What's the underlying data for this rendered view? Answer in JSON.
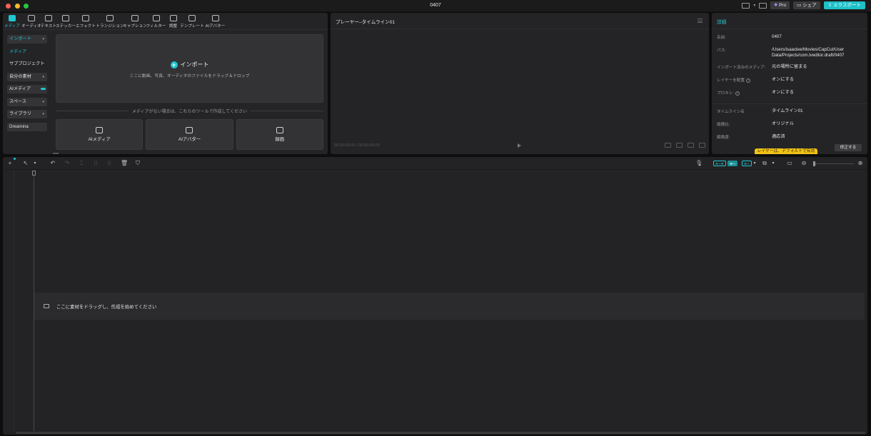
{
  "window": {
    "title": "0407",
    "buttons": {
      "pro": "Pro",
      "share": "シェア",
      "export": "エクスポート"
    }
  },
  "media": {
    "tabs": [
      {
        "label": "メディア",
        "icon": "media-icon"
      },
      {
        "label": "オーディオ",
        "icon": "audio-icon"
      },
      {
        "label": "テキスト",
        "icon": "text-icon"
      },
      {
        "label": "ステッカー",
        "icon": "sticker-icon"
      },
      {
        "label": "エフェクト",
        "icon": "effect-icon"
      },
      {
        "label": "トランジション",
        "icon": "transition-icon"
      },
      {
        "label": "キャプション",
        "icon": "caption-icon"
      },
      {
        "label": "フィルター",
        "icon": "filter-icon"
      },
      {
        "label": "調整",
        "icon": "adjust-icon"
      },
      {
        "label": "テンプレート",
        "icon": "template-icon"
      },
      {
        "label": "AIアバター",
        "icon": "ai-avatar-icon"
      }
    ],
    "sidebar": [
      {
        "label": "インポート",
        "style": "active-box"
      },
      {
        "label": "メディア",
        "style": "active-text"
      },
      {
        "label": "サブプロジェクト",
        "style": "plain"
      },
      {
        "label": "自分の素材",
        "style": "box"
      },
      {
        "label": "AIメディア",
        "style": "box"
      },
      {
        "label": "スペース",
        "style": "box"
      },
      {
        "label": "ライブラリ",
        "style": "box"
      },
      {
        "label": "Dreamina",
        "style": "box"
      }
    ],
    "import_zone": {
      "title": "インポート",
      "hint": "ここに動画、写真、オーディオのファイルをドラッグ＆ドロップ"
    },
    "divider_text": "メディアがない場合は、これらのツールで作成してください",
    "tool_cards": [
      {
        "label": "AIメディア",
        "icon": "ai-media-icon"
      },
      {
        "label": "AIアバター",
        "icon": "ai-avatar-icon"
      },
      {
        "label": "録画",
        "icon": "record-icon"
      }
    ]
  },
  "player": {
    "title": "プレーヤー–タイムライン01",
    "timecode": "00:00:00:00 / 00:00:00:00"
  },
  "details": {
    "title": "詳細",
    "rows": [
      {
        "key": "名前:",
        "value": "0407"
      },
      {
        "key": "パス:",
        "value": "/Users/isaaclee/Movies/CapCut/User Data/Projects/com.lveditor.draft/0407"
      },
      {
        "key": "インポート済みのメディア:",
        "value": "元の場所に留まる"
      },
      {
        "key": "レイヤーを配置",
        "value": "オンにする",
        "help": true
      },
      {
        "key": "プロキシ:",
        "value": "オンにする",
        "help": true
      },
      {
        "key": "タイムライン名",
        "value": "タイムライン01"
      },
      {
        "key": "縦横比:",
        "value": "オリジナル"
      },
      {
        "key": "解像度:",
        "value": "適応済"
      }
    ],
    "tooltip": "レイヤーは、デフォルトで有効",
    "modify_button": "修正する"
  },
  "timeline": {
    "drop_text": "ここに素材をドラッグし、作成を始めてください",
    "chips": [
      "⊕⊸⊕",
      "⊕⊸",
      "⊕⊸"
    ]
  },
  "colors": {
    "accent": "#22c6cf",
    "export": "#1fc0c8",
    "tooltip": "#f2c318"
  }
}
